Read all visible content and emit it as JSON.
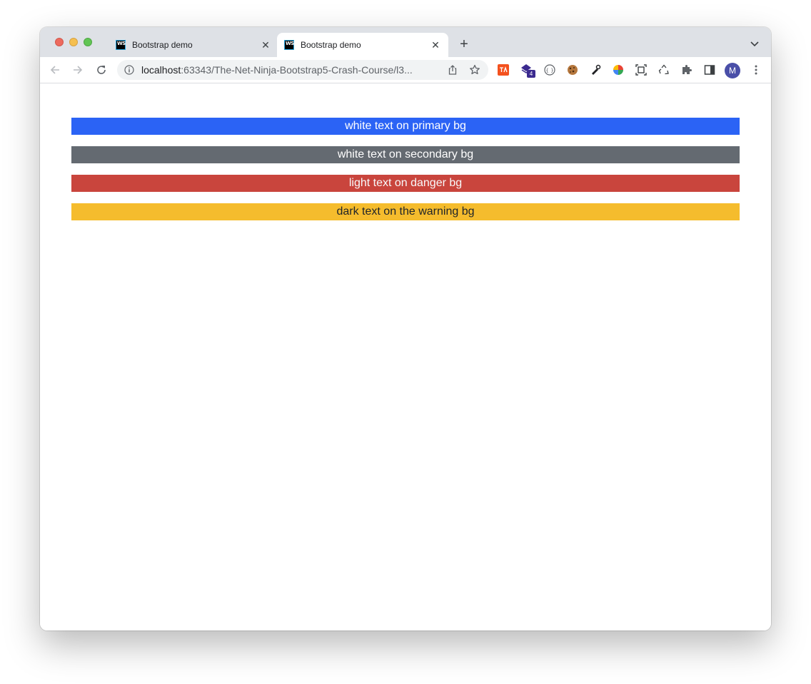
{
  "browser": {
    "tabs": [
      {
        "title": "Bootstrap demo",
        "favicon_text": "WS",
        "close": "✕"
      },
      {
        "title": "Bootstrap demo",
        "favicon_text": "WS",
        "close": "✕"
      }
    ],
    "new_tab": "+",
    "url_host": "localhost",
    "url_rest": ":63343/The-Net-Ninja-Bootstrap5-Crash-Course/l3...",
    "avatar_letter": "M",
    "extension_badge": "4"
  },
  "colors": {
    "primary": "#2b63f5",
    "secondary": "#646a71",
    "danger": "#c9453d",
    "warning": "#f5bc2d"
  },
  "page": {
    "bars": [
      {
        "text": "white text on primary bg"
      },
      {
        "text": "white text on secondary bg"
      },
      {
        "text": "light text on danger bg"
      },
      {
        "text": "dark text on the warning bg"
      }
    ]
  }
}
